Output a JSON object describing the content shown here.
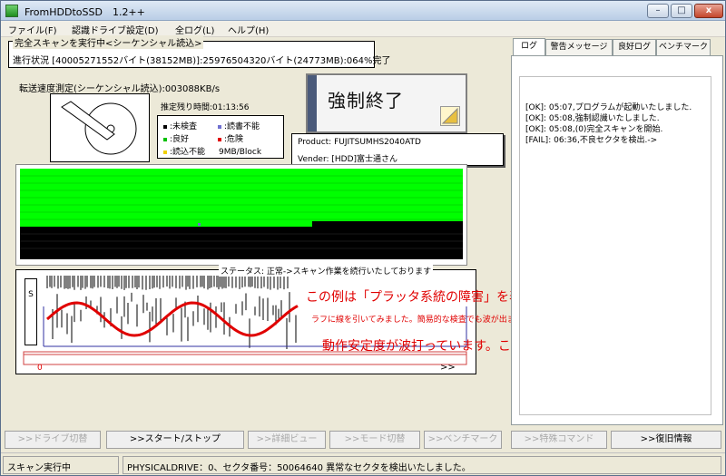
{
  "window": {
    "title": "FromHDDtoSSD　1.2++",
    "controls": {
      "minimize": "–",
      "maximize": "□",
      "close": "x"
    }
  },
  "menu": [
    "ファイル(F)",
    "認識ドライブ設定(D)",
    "全ログ(L)",
    "ヘルプ(H)"
  ],
  "scan": {
    "caption": "完全スキャンを実行中<シーケンシャル読込>",
    "progress": "進行状況 [40005271552バイト(38152MB)]:25976504320バイト(24773MB):064%完了"
  },
  "speed": "転送速度測定(シーケンシャル読込):003088KB/s",
  "remaining": "推定残り時間:01:13:56",
  "legend": [
    {
      "label": ":未検査",
      "color": "#000000"
    },
    {
      "label": ":読書不能",
      "color": "#7070d0"
    },
    {
      "label": ":良好",
      "color": "#00c000"
    },
    {
      "label": ":危険",
      "color": "#e00000"
    },
    {
      "label": ":読込不能",
      "color": "#f0d000"
    }
  ],
  "block_size": "9MB/Block",
  "force_stop_label": "強制終了",
  "drive_info": {
    "product": "Product: FUJITSUMHS2040ATD",
    "vender": "Vender: [HDD]富士通さん"
  },
  "status_caption": "ステータス: 正常->スキャン作業を続行いたしております",
  "s_label": "S",
  "range": {
    "start": "0",
    "end": ">>"
  },
  "annotations": {
    "line1": "この例は「プラッタ系統の障害」を表す事例です。",
    "line2": "ラフに線を引いてみました。簡易的な検査でも波が出ます。実際の復旧ではさらに高精度です。",
    "line3": "動作安定度が波打っています。これが異常のサインです。"
  },
  "buttons": [
    {
      "label": ">>ドライブ切替",
      "enabled": false
    },
    {
      "label": ">>スタート/ストップ",
      "enabled": true
    },
    {
      "label": ">>詳細ビュー",
      "enabled": false
    },
    {
      "label": ">>モード切替",
      "enabled": false
    },
    {
      "label": ">>ベンチマーク",
      "enabled": false
    },
    {
      "label": ">>特殊コマンド",
      "enabled": false
    },
    {
      "label": ">>復旧情報",
      "enabled": true
    }
  ],
  "statusbar": {
    "left": "スキャン実行中",
    "right": "PHYSICALDRIVE：0、セクタ番号：50064640 異常なセクタを検出いたしました。"
  },
  "tabs": [
    "ログ",
    "警告メッセージ",
    "良好ログ",
    "ベンチマーク"
  ],
  "log_lines": [
    "[OK]: 05:07,プログラムが起動いたしました.",
    "[OK]: 05:08,強制認識いたしました.",
    "[OK]: 05:08,(0)完全スキャンを開始.",
    "[FAIL]: 06:36,不良セクタを検出.->"
  ],
  "colors": {
    "good": "#00ff00",
    "unchecked": "#000000",
    "wave": "#e00000",
    "warn_line": "#d04040",
    "guide_line": "#3030a0"
  }
}
